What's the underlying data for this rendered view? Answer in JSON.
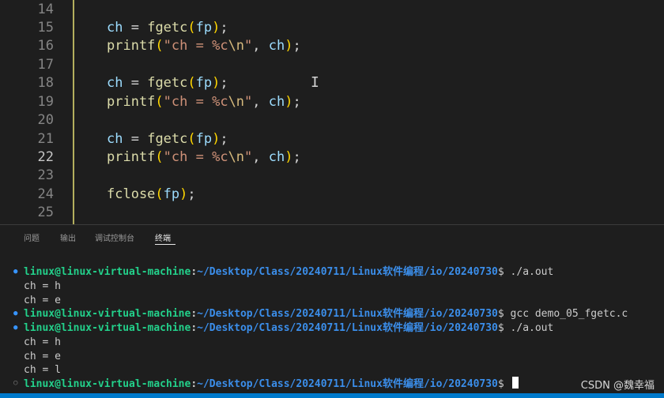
{
  "editor": {
    "lines": [
      {
        "num": "14"
      },
      {
        "num": "15",
        "parts": [
          [
            "v",
            "ch"
          ],
          [
            "o",
            " = "
          ],
          [
            "f",
            "fgetc"
          ],
          [
            "p",
            "("
          ],
          [
            "v",
            "fp"
          ],
          [
            "p",
            ")"
          ],
          [
            "o",
            ";"
          ]
        ]
      },
      {
        "num": "16",
        "parts": [
          [
            "f",
            "printf"
          ],
          [
            "p",
            "("
          ],
          [
            "s",
            "\"ch = %c"
          ],
          [
            "e",
            "\\n"
          ],
          [
            "s",
            "\""
          ],
          [
            "o",
            ", "
          ],
          [
            "v",
            "ch"
          ],
          [
            "p",
            ")"
          ],
          [
            "o",
            ";"
          ]
        ]
      },
      {
        "num": "17"
      },
      {
        "num": "18",
        "parts": [
          [
            "v",
            "ch"
          ],
          [
            "o",
            " = "
          ],
          [
            "f",
            "fgetc"
          ],
          [
            "p",
            "("
          ],
          [
            "v",
            "fp"
          ],
          [
            "p",
            ")"
          ],
          [
            "o",
            ";"
          ]
        ]
      },
      {
        "num": "19",
        "parts": [
          [
            "f",
            "printf"
          ],
          [
            "p",
            "("
          ],
          [
            "s",
            "\"ch = %c"
          ],
          [
            "e",
            "\\n"
          ],
          [
            "s",
            "\""
          ],
          [
            "o",
            ", "
          ],
          [
            "v",
            "ch"
          ],
          [
            "p",
            ")"
          ],
          [
            "o",
            ";"
          ]
        ]
      },
      {
        "num": "20"
      },
      {
        "num": "21",
        "parts": [
          [
            "v",
            "ch"
          ],
          [
            "o",
            " = "
          ],
          [
            "f",
            "fgetc"
          ],
          [
            "p",
            "("
          ],
          [
            "v",
            "fp"
          ],
          [
            "p",
            ")"
          ],
          [
            "o",
            ";"
          ]
        ]
      },
      {
        "num": "22",
        "parts": [
          [
            "f",
            "printf"
          ],
          [
            "p",
            "("
          ],
          [
            "s",
            "\"ch = %c"
          ],
          [
            "e",
            "\\n"
          ],
          [
            "s",
            "\""
          ],
          [
            "o",
            ", "
          ],
          [
            "v",
            "ch"
          ],
          [
            "p",
            ")"
          ],
          [
            "o",
            ";"
          ]
        ]
      },
      {
        "num": "23"
      },
      {
        "num": "24",
        "parts": [
          [
            "f",
            "fclose"
          ],
          [
            "p",
            "("
          ],
          [
            "v",
            "fp"
          ],
          [
            "p",
            ")"
          ],
          [
            "o",
            ";"
          ]
        ]
      },
      {
        "num": "25"
      }
    ]
  },
  "panel": {
    "tabs": [
      "问题",
      "输出",
      "调试控制台",
      "终端"
    ],
    "active_tab": "终端"
  },
  "terminal": {
    "user": "linux@linux-virtual-machine",
    "path": "~/Desktop/Class/20240711/Linux软件编程/io/20240730",
    "commands": [
      "./a.out",
      "gcc demo_05_fgetc.c",
      "./a.out",
      ""
    ],
    "outputs": [
      "ch = h",
      "ch = e",
      "ch = h",
      "ch = e",
      "ch = l"
    ]
  },
  "watermark": "CSDN @魏幸福",
  "colors": {
    "accent": "#007acc",
    "prompt_user": "#23d18b",
    "prompt_path": "#3b8eea",
    "guide": "#cfc96a"
  }
}
